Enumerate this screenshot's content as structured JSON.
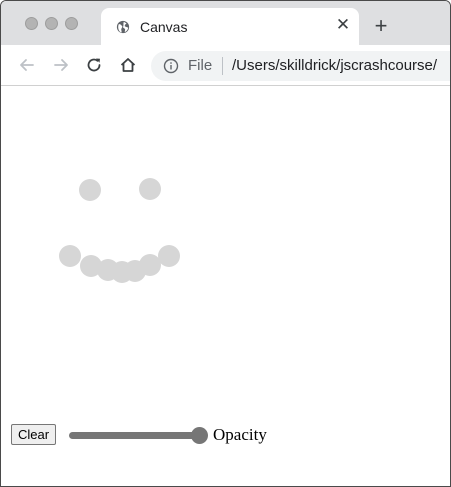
{
  "window": {
    "tab_title": "Canvas",
    "tab_close": "✕",
    "new_tab": "+"
  },
  "toolbar": {
    "scheme_label": "File",
    "url": "/Users/skilldrick/jscrashcourse/"
  },
  "controls": {
    "clear_label": "Clear",
    "opacity_label": "Opacity",
    "opacity_value": 1.0
  },
  "colors": {
    "dot_fill": "#d6d6d6",
    "slider": "#767676",
    "tabstrip": "#dedfe1"
  },
  "icons": [
    "globe-icon",
    "close-icon",
    "plus-icon",
    "back-arrow-icon",
    "forward-arrow-icon",
    "reload-icon",
    "home-icon",
    "info-icon"
  ]
}
